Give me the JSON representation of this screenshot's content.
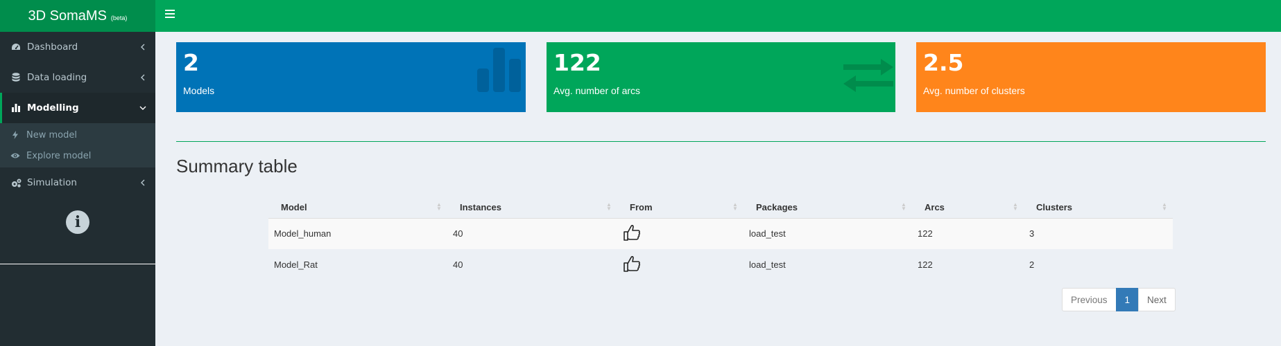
{
  "app": {
    "title": "3D SomaMS",
    "badge": "(beta)"
  },
  "sidebar": {
    "items": [
      {
        "label": "Dashboard",
        "icon": "dashboard-icon"
      },
      {
        "label": "Data loading",
        "icon": "database-icon"
      },
      {
        "label": "Modelling",
        "icon": "bar-chart-icon"
      },
      {
        "label": "Simulation",
        "icon": "gears-icon"
      }
    ],
    "modelling_sub": [
      {
        "label": "New model",
        "icon": "bolt-icon"
      },
      {
        "label": "Explore model",
        "icon": "eye-icon"
      }
    ]
  },
  "value_boxes": [
    {
      "value": "2",
      "caption": "Models",
      "color": "#0073b7",
      "icon": "bar-chart-icon"
    },
    {
      "value": "122",
      "caption": "Avg. number of arcs",
      "color": "#00a65a",
      "icon": "exchange-icon"
    },
    {
      "value": "2.5",
      "caption": "Avg. number of clusters",
      "color": "#ff851b",
      "icon": ""
    }
  ],
  "summary": {
    "title": "Summary table",
    "columns": [
      "Model",
      "Instances",
      "From",
      "Packages",
      "Arcs",
      "Clusters"
    ],
    "rows": [
      {
        "model": "Model_human",
        "instances": "40",
        "from": "thumbs-up-icon",
        "packages": "load_test",
        "arcs": "122",
        "clusters": "3"
      },
      {
        "model": "Model_Rat",
        "instances": "40",
        "from": "thumbs-up-icon",
        "packages": "load_test",
        "arcs": "122",
        "clusters": "2"
      }
    ]
  },
  "pagination": {
    "previous": "Previous",
    "current": "1",
    "next": "Next"
  }
}
